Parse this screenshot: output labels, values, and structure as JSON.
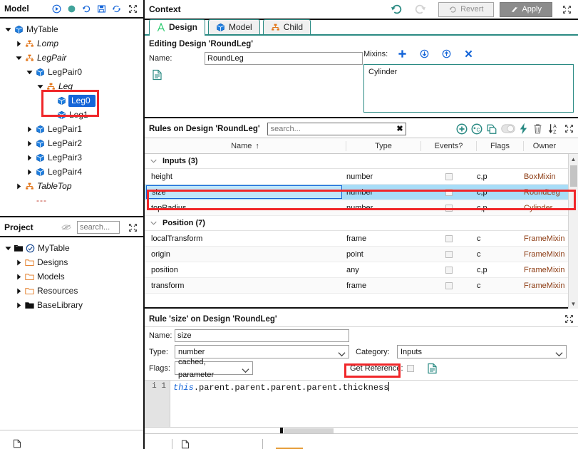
{
  "model_panel": {
    "title": "Model",
    "toolbar_icons": [
      "play-icon",
      "record-icon",
      "history-icon",
      "save-icon",
      "refresh-icon",
      "expand-icon"
    ],
    "tree": [
      {
        "label": "MyTable",
        "depth": 0,
        "twisty": "down",
        "icon": "cube-icon",
        "italic": false,
        "selected": false
      },
      {
        "label": "Lomp",
        "depth": 1,
        "twisty": "right",
        "icon": "hierarchy-icon",
        "italic": true,
        "selected": false
      },
      {
        "label": "LegPair",
        "depth": 1,
        "twisty": "down",
        "icon": "hierarchy-icon",
        "italic": true,
        "selected": false
      },
      {
        "label": "LegPair0",
        "depth": 2,
        "twisty": "down",
        "icon": "cube-icon",
        "italic": false,
        "selected": false
      },
      {
        "label": "Leg",
        "depth": 3,
        "twisty": "down",
        "icon": "hierarchy-icon",
        "italic": true,
        "selected": false
      },
      {
        "label": "Leg0",
        "depth": 4,
        "twisty": "none",
        "icon": "cube-icon",
        "italic": false,
        "selected": true
      },
      {
        "label": "Leg1",
        "depth": 4,
        "twisty": "none",
        "icon": "cube-icon",
        "italic": false,
        "selected": false
      },
      {
        "label": "LegPair1",
        "depth": 2,
        "twisty": "right",
        "icon": "cube-icon",
        "italic": false,
        "selected": false
      },
      {
        "label": "LegPair2",
        "depth": 2,
        "twisty": "right",
        "icon": "cube-icon",
        "italic": false,
        "selected": false
      },
      {
        "label": "LegPair3",
        "depth": 2,
        "twisty": "right",
        "icon": "cube-icon",
        "italic": false,
        "selected": false
      },
      {
        "label": "LegPair4",
        "depth": 2,
        "twisty": "right",
        "icon": "cube-icon",
        "italic": false,
        "selected": false
      },
      {
        "label": "TableTop",
        "depth": 1,
        "twisty": "right",
        "icon": "hierarchy-icon",
        "italic": true,
        "selected": false
      },
      {
        "label": "---",
        "depth": 2,
        "twisty": "none",
        "icon": "none",
        "italic": false,
        "selected": false
      }
    ]
  },
  "project_panel": {
    "title": "Project",
    "search_placeholder": "search...",
    "search_value": "",
    "tree": [
      {
        "label": "MyTable",
        "depth": 0,
        "twisty": "down",
        "icon": "project-check-icon"
      },
      {
        "label": "Designs",
        "depth": 1,
        "twisty": "right",
        "icon": "folder-icon"
      },
      {
        "label": "Models",
        "depth": 1,
        "twisty": "right",
        "icon": "folder-icon"
      },
      {
        "label": "Resources",
        "depth": 1,
        "twisty": "right",
        "icon": "folder-icon"
      },
      {
        "label": "BaseLibrary",
        "depth": 1,
        "twisty": "right",
        "icon": "folder-filled-icon"
      }
    ]
  },
  "context": {
    "title": "Context",
    "undo_label": "undo-icon",
    "redo_label": "redo-icon",
    "revert_label": "Revert",
    "apply_label": "Apply",
    "tabs": [
      {
        "label": "Design",
        "icon": "design-a-icon",
        "active": true
      },
      {
        "label": "Model",
        "icon": "cube-icon",
        "active": false
      },
      {
        "label": "Child",
        "icon": "hierarchy-icon",
        "active": false
      }
    ]
  },
  "design": {
    "editing_title": "Editing Design 'RoundLeg'",
    "name_label": "Name:",
    "name_value": "RoundLeg",
    "mixins_label": "Mixins:",
    "mixins_buttons": [
      "plus-icon",
      "move-down-icon",
      "move-up-icon",
      "remove-x-icon"
    ],
    "mixins_items": [
      "Cylinder"
    ],
    "doc_icon": "document-icon"
  },
  "rules": {
    "title": "Rules on Design 'RoundLeg'",
    "search_placeholder": "search...",
    "search_value": "",
    "search_clear": "✖",
    "toolbar_icons": [
      "add-rule-icon",
      "add-computed-rule-icon",
      "duplicate-icon",
      "toggle-icon",
      "flash-icon",
      "delete-icon",
      "sort-az-icon",
      "expand-icon"
    ],
    "columns": [
      {
        "label": "Name",
        "sort": "↑"
      },
      {
        "label": "Type",
        "sort": ""
      },
      {
        "label": "Events?",
        "sort": ""
      },
      {
        "label": "Flags",
        "sort": ""
      },
      {
        "label": "Owner",
        "sort": ""
      }
    ],
    "groups": [
      {
        "label": "Inputs (3)",
        "rows": [
          {
            "name": "height",
            "type": "number",
            "events": false,
            "flags": "c,p",
            "owner": "BoxMixin",
            "selected": false,
            "editing": false
          },
          {
            "name": "size",
            "type": "number",
            "events": false,
            "flags": "c,p",
            "owner": "RoundLeg",
            "selected": true,
            "editing": true
          },
          {
            "name": "topRadius",
            "type": "number",
            "events": false,
            "flags": "c,p",
            "owner": "Cylinder",
            "selected": false,
            "editing": false
          }
        ]
      },
      {
        "label": "Position (7)",
        "rows": [
          {
            "name": "localTransform",
            "type": "frame",
            "events": false,
            "flags": "c",
            "owner": "FrameMixin",
            "selected": false,
            "editing": false
          },
          {
            "name": "origin",
            "type": "point",
            "events": false,
            "flags": "c",
            "owner": "FrameMixin",
            "selected": false,
            "editing": false
          },
          {
            "name": "position",
            "type": "any",
            "events": false,
            "flags": "c,p",
            "owner": "FrameMixin",
            "selected": false,
            "editing": false
          },
          {
            "name": "transform",
            "type": "frame",
            "events": false,
            "flags": "c",
            "owner": "FrameMixin",
            "selected": false,
            "editing": false
          }
        ]
      }
    ]
  },
  "rule_detail": {
    "title": "Rule 'size' on Design 'RoundLeg'",
    "name_label": "Name:",
    "name_value": "size",
    "type_label": "Type:",
    "type_value": "number",
    "category_label": "Category:",
    "category_value": "Inputs",
    "flags_label": "Flags:",
    "flags_value": "cached, parameter",
    "get_reference_label": "Get Reference:",
    "get_reference_checked": false,
    "doc_icon": "document-icon",
    "code": {
      "line_number": "1",
      "gutter_marker": "i",
      "keyword": "this",
      "rest": ".parent.parent.parent.parent.thickness",
      "full_text": "this.parent.parent.parent.parent.thickness"
    }
  },
  "colors": {
    "accent_teal": "#2a8a83",
    "selection_blue": "#1565d8",
    "row_selected": "#a8ddf8",
    "annotation_red": "#f0272a",
    "owner_text": "#8c3b12",
    "apply_button": "#8c8c8c"
  }
}
